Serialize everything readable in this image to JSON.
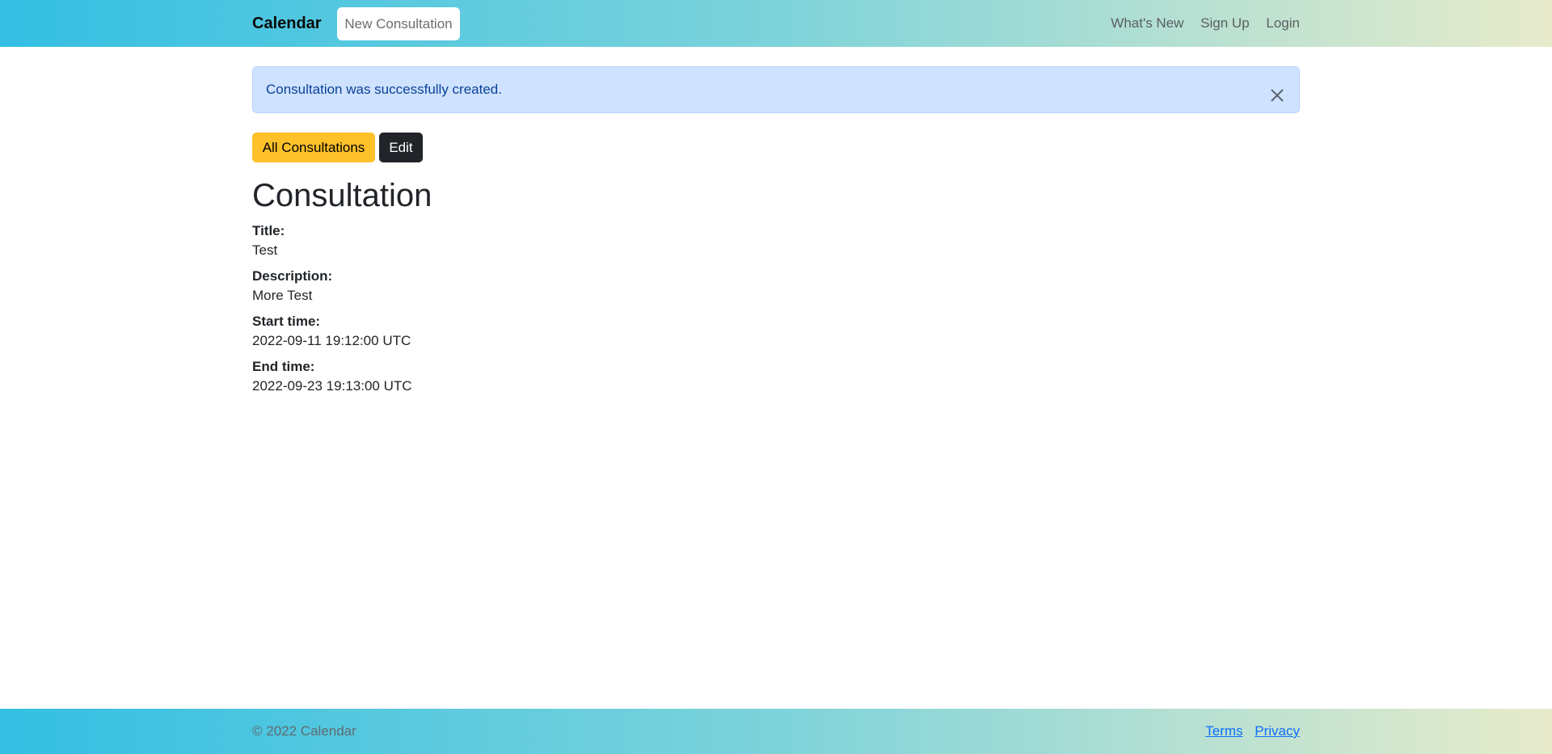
{
  "navbar": {
    "brand": "Calendar",
    "new_consultation": "New Consultation",
    "links": [
      "What's New",
      "Sign Up",
      "Login"
    ]
  },
  "alert": {
    "message": "Consultation was successfully created.",
    "close_icon": "close-icon"
  },
  "actions": {
    "all_consultations": "All Consultations",
    "edit": "Edit"
  },
  "page": {
    "title": "Consultation"
  },
  "fields": [
    {
      "label": "Title:",
      "value": "Test"
    },
    {
      "label": "Description:",
      "value": "More Test"
    },
    {
      "label": "Start time:",
      "value": "2022-09-11 19:12:00 UTC"
    },
    {
      "label": "End time:",
      "value": "2022-09-23 19:13:00 UTC"
    }
  ],
  "footer": {
    "copyright": "© 2022 Calendar",
    "terms": "Terms",
    "privacy": "Privacy"
  },
  "colors": {
    "alert_bg": "#cfe2ff",
    "alert_text": "#084298",
    "warning_button": "#ffc12a",
    "dark_button": "#212529",
    "link": "#0d6efd"
  }
}
